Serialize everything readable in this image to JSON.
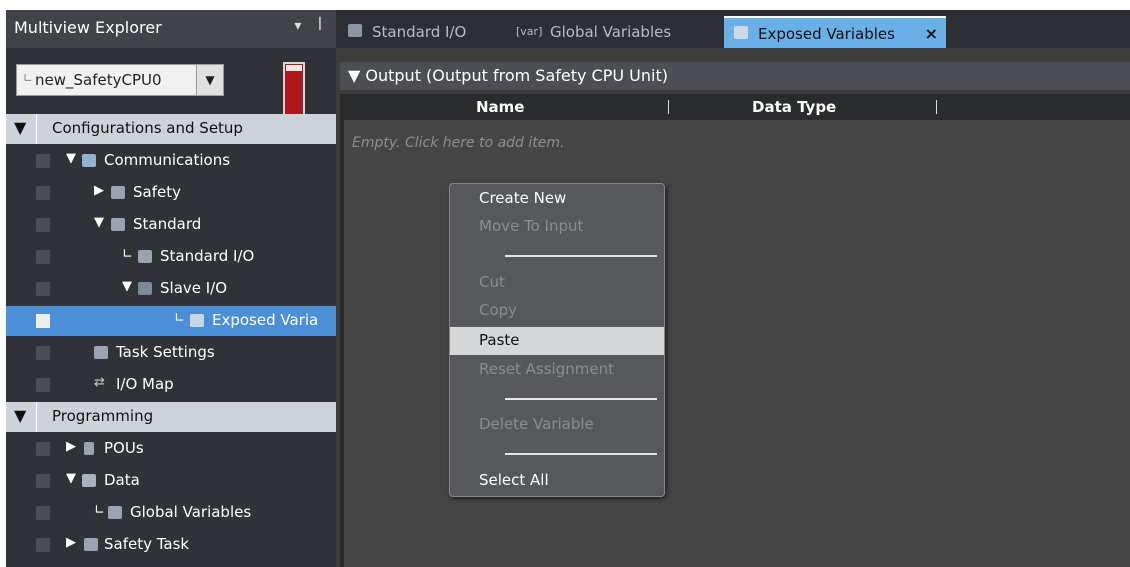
{
  "explorer": {
    "title": "Multiview Explorer",
    "controls": "▾ ꟾ",
    "device_prefix": "∟",
    "device_value": "new_SafetyCPU0",
    "tree": [
      {
        "label": "Configurations and Setup",
        "kind": "section"
      },
      {
        "label": "Communications"
      },
      {
        "label": "Safety"
      },
      {
        "label": "Standard"
      },
      {
        "label": "Standard I/O"
      },
      {
        "label": "Slave I/O"
      },
      {
        "label": "Exposed Varia",
        "selected": true
      },
      {
        "label": "Task Settings"
      },
      {
        "label": "I/O Map"
      },
      {
        "label": "Programming",
        "kind": "section"
      },
      {
        "label": "POUs"
      },
      {
        "label": "Data"
      },
      {
        "label": "Global Variables"
      },
      {
        "label": "Safety Task"
      }
    ]
  },
  "tabs": [
    {
      "label": "Standard I/O",
      "icon": "standard-io-icon"
    },
    {
      "label": "Global Variables",
      "icon_text": "[var]",
      "icon": "var-icon"
    },
    {
      "label": "Exposed Variables",
      "icon": "exposed-variables-icon",
      "active": true,
      "close": "×"
    }
  ],
  "section_header": "▼ Output (Output from Safety CPU Unit)",
  "columns": [
    "Name",
    "Data Type"
  ],
  "empty_hint": "Empty. Click here to add item.",
  "context_menu": [
    {
      "label": "Create New",
      "state": "enabled"
    },
    {
      "label": "Move To Input",
      "state": "disabled"
    },
    {
      "label": "Cut",
      "state": "disabled"
    },
    {
      "label": "Copy",
      "state": "disabled"
    },
    {
      "label": "Paste",
      "state": "highlight"
    },
    {
      "label": "Reset Assignment",
      "state": "disabled"
    },
    {
      "label": "Delete Variable",
      "state": "disabled"
    },
    {
      "label": "Select All",
      "state": "enabled"
    }
  ],
  "colors": {
    "accent": "#6ab0e6",
    "selection": "#4c8fd6",
    "status_red": "#b0151a"
  }
}
